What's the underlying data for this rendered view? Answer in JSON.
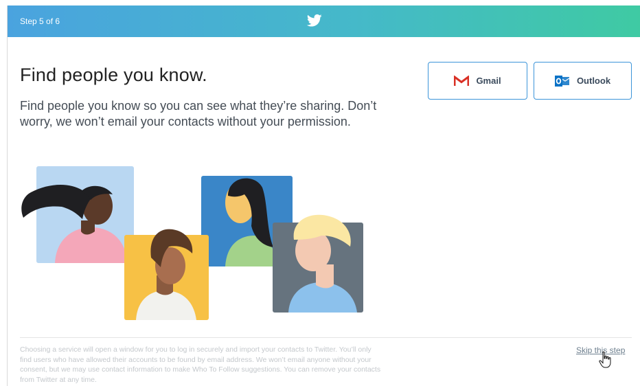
{
  "header": {
    "step_label": "Step 5 of 6",
    "logo_icon": "twitter-bird-icon",
    "gradient_colors": [
      "#4aa3df",
      "#3fcaa3"
    ]
  },
  "main": {
    "title": "Find people you know.",
    "description": "Find people you know so you can see what they’re sharing. Don’t worry, we won’t email your contacts without your permission."
  },
  "services": [
    {
      "label": "Gmail",
      "icon": "gmail-icon"
    },
    {
      "label": "Outlook",
      "icon": "outlook-icon"
    }
  ],
  "footer": {
    "fine_print": "Choosing a service will open a window for you to log in securely and import your contacts to Twitter. You’ll only find users who have allowed their accounts to be found by email address. We won’t email anyone without your consent, but we may use contact information to make Who To Follow suggestions. You can remove your contacts from Twitter at any time.",
    "skip_label": "Skip this step"
  },
  "colors": {
    "accent": "#3b94d9",
    "gmail_red": "#d93025",
    "outlook_blue": "#0a72c6"
  }
}
